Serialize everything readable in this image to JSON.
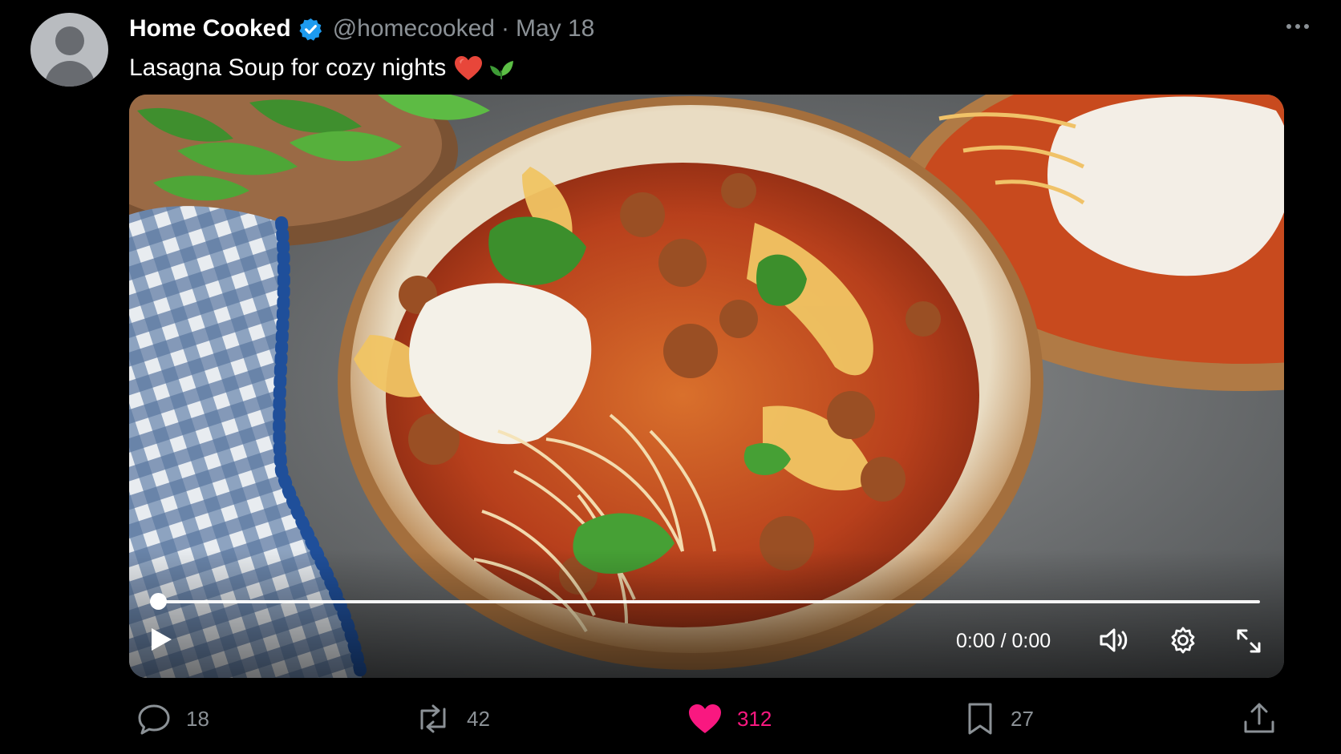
{
  "post": {
    "author": {
      "display_name": "Home Cooked",
      "handle": "@homecooked",
      "verified": true,
      "avatar_icon": "default-avatar-icon"
    },
    "separator": "·",
    "date": "May 18",
    "text": "Lasagna Soup for cozy nights",
    "emojis": [
      "red-heart",
      "seedling"
    ]
  },
  "video": {
    "thumbnail": "lasagna soup bowl photo",
    "time_display": "0:00 / 0:00",
    "progress": 0,
    "controls": [
      "play-icon",
      "volume-icon",
      "settings-gear-icon",
      "fullscreen-icon"
    ]
  },
  "actions": {
    "replies": "18",
    "reposts": "42",
    "likes": "312",
    "bookmarks": "27",
    "liked": true
  },
  "colors": {
    "background": "#000000",
    "secondary_text": "#8b9196",
    "verified_blue": "#1d9bf0",
    "like_pink": "#f91880"
  }
}
